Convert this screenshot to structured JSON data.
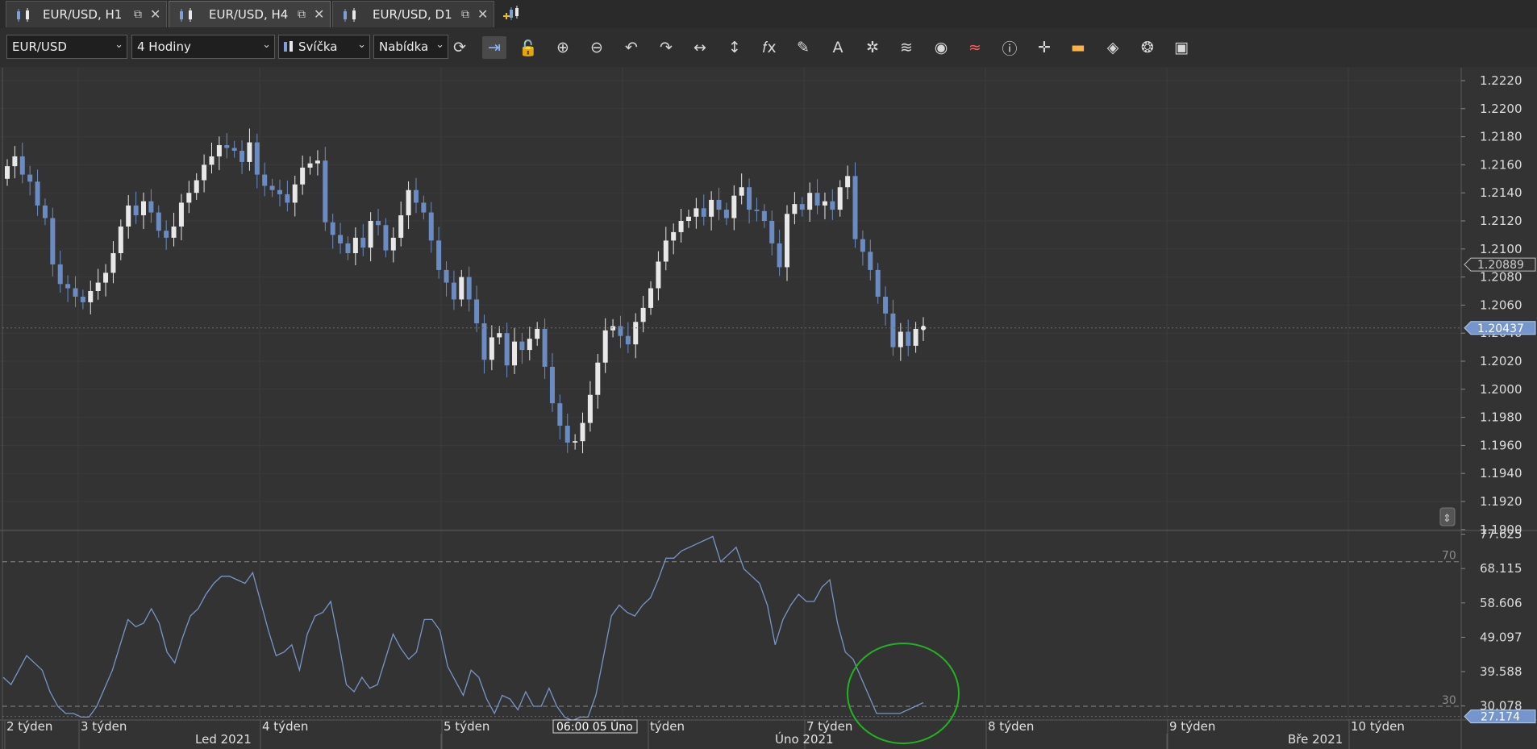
{
  "tabs": [
    {
      "label": "EUR/USD, H1",
      "active": false
    },
    {
      "label": "EUR/USD, H4",
      "active": true
    },
    {
      "label": "EUR/USD, D1",
      "active": false
    }
  ],
  "toolbar": {
    "instrument": "EUR/USD",
    "period": "4 Hodiny",
    "chart_type": "Svíčka",
    "offer_side": "Nabídka",
    "buttons": [
      "refresh-icon",
      "autoshift-icon",
      "unlock-icon",
      "zoom-in-icon",
      "zoom-out-icon",
      "undo-icon",
      "redo-icon",
      "horizontal-resize-icon",
      "vertical-resize-icon",
      "indicators-fx-icon",
      "draw-pencil-icon",
      "text-tool-icon",
      "pattern-icon",
      "layers-icon",
      "eye-icon",
      "drawdown-icon",
      "info-icon",
      "crosshair-icon",
      "volume-bars-icon",
      "paint-bucket-icon",
      "theme-icon",
      "save-icon"
    ]
  },
  "colors": {
    "background": "#333333",
    "bull": "#e8e8e8",
    "bear": "#6b8cc2",
    "rsi": "#7896c8",
    "highlight_circle": "#22b322",
    "price_tag_bg": "#7496cc"
  },
  "chart_data": [
    {
      "type": "candlestick",
      "symbol": "EUR/USD",
      "timeframe": "H4",
      "ylim": [
        1.19,
        1.223
      ],
      "y_ticks": [
        "1.2220",
        "1.2200",
        "1.2180",
        "1.2160",
        "1.2140",
        "1.2120",
        "1.2100",
        "1.2080",
        "1.2060",
        "1.2040",
        "1.2020",
        "1.2000",
        "1.1980",
        "1.1960",
        "1.1940",
        "1.1920",
        "1.1900"
      ],
      "price_markers": [
        {
          "label": "1.20889",
          "value": 1.20889,
          "style": "outline"
        },
        {
          "label": "1.20437",
          "value": 1.20437,
          "style": "filled"
        }
      ],
      "current_price": 1.20437,
      "close_series": [
        1.2159,
        1.2166,
        1.2153,
        1.2148,
        1.2131,
        1.2122,
        1.2089,
        1.2075,
        1.2072,
        1.2066,
        1.2062,
        1.207,
        1.2076,
        1.2083,
        1.2097,
        1.2116,
        1.2131,
        1.2124,
        1.2134,
        1.2126,
        1.2113,
        1.2108,
        1.2116,
        1.2133,
        1.214,
        1.2149,
        1.216,
        1.2166,
        1.2174,
        1.2172,
        1.217,
        1.2162,
        1.2176,
        1.2153,
        1.2145,
        1.2142,
        1.2139,
        1.2133,
        1.2146,
        1.2158,
        1.2161,
        1.2163,
        1.2119,
        1.211,
        1.2104,
        1.2097,
        1.2108,
        1.2101,
        1.212,
        1.2117,
        1.2099,
        1.2108,
        1.2124,
        1.2142,
        1.2133,
        1.2126,
        1.2106,
        1.2085,
        1.2076,
        1.2064,
        1.208,
        1.2064,
        1.2047,
        1.2021,
        1.2037,
        1.204,
        1.2017,
        1.2034,
        1.2028,
        1.2036,
        1.2043,
        1.2016,
        1.199,
        1.1974,
        1.1962,
        1.1963,
        1.1976,
        1.1996,
        1.2019,
        1.2042,
        1.2045,
        1.2038,
        1.2032,
        1.2048,
        1.2058,
        1.2072,
        1.2091,
        1.2106,
        1.2112,
        1.212,
        1.2123,
        1.2129,
        1.2123,
        1.2135,
        1.2128,
        1.2122,
        1.2138,
        1.2144,
        1.2128,
        1.2127,
        1.212,
        1.2104,
        1.2087,
        1.2125,
        1.2132,
        1.2128,
        1.214,
        1.2131,
        1.2134,
        1.2128,
        1.2144,
        1.2152,
        1.2107,
        1.2098,
        1.2085,
        1.2066,
        1.2054,
        1.203,
        1.2041,
        1.2031,
        1.2043,
        1.2044
      ],
      "rsi": {
        "name": "RSI",
        "ylim": [
          26.2,
          78.2
        ],
        "y_ticks": [
          "77.625",
          "68.115",
          "58.606",
          "49.097",
          "39.588",
          "30.078"
        ],
        "levels": [
          {
            "label": "70",
            "value": 70
          },
          {
            "label": "30",
            "value": 30
          }
        ],
        "current": {
          "label": "27.174",
          "value": 27.174
        },
        "series": [
          38,
          36,
          40,
          44,
          42,
          40,
          34,
          30,
          28,
          28,
          27,
          27,
          30,
          35,
          40,
          47,
          54,
          52,
          53,
          57,
          53,
          45,
          42,
          49,
          55,
          57,
          61,
          64,
          66,
          66,
          65,
          64,
          67,
          59,
          51,
          44,
          45,
          47,
          40,
          50,
          55,
          56,
          59,
          48,
          36,
          34,
          38,
          35,
          36,
          43,
          50,
          46,
          43,
          45,
          54,
          54,
          51,
          41,
          37,
          33,
          40,
          38,
          32,
          28,
          33,
          32,
          29,
          34,
          30,
          30,
          35,
          30,
          27,
          26,
          27,
          27,
          33,
          44,
          55,
          58,
          56,
          55,
          58,
          60,
          65,
          71,
          71,
          73,
          74,
          75,
          76,
          77,
          70,
          72,
          74,
          68,
          66,
          64,
          58,
          47,
          54,
          58,
          61,
          59,
          59,
          63,
          65,
          53,
          45,
          43,
          38,
          33,
          28,
          28,
          28,
          28,
          29,
          30,
          31
        ]
      },
      "x_weeks": [
        "2 týden",
        "3 týden",
        "4 týden",
        "5 týden",
        "týden",
        "7 týden",
        "8 týden",
        "9 týden",
        "10 týden"
      ],
      "x_months": [
        "Led 2021",
        "Úno 2021",
        "Bře 2021"
      ],
      "cursor_time": "06:00 05 Úno"
    }
  ]
}
